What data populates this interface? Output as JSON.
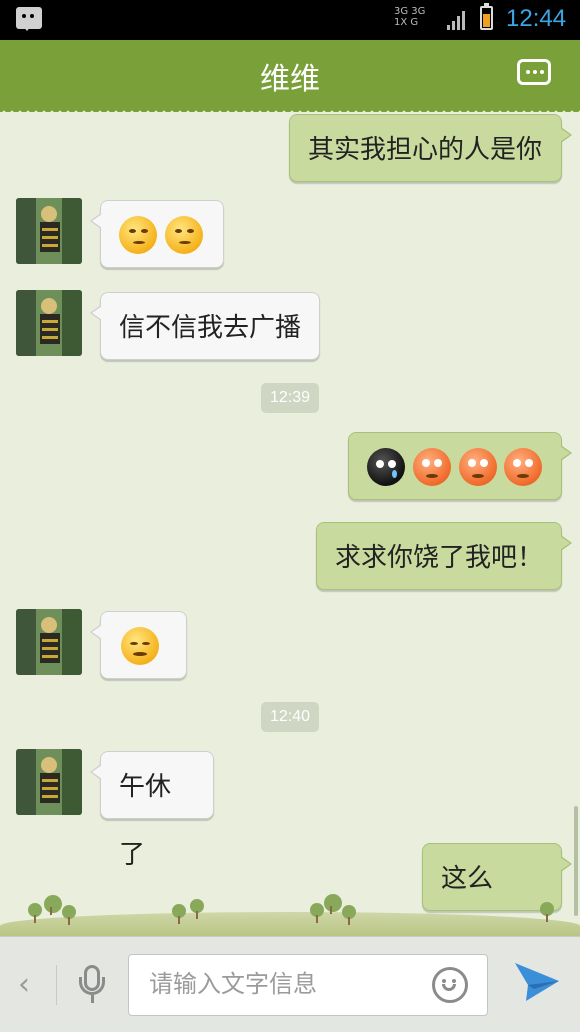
{
  "status_bar": {
    "network_top": "3G 3G 1X G",
    "time": "12:44",
    "battery_level": 0.7
  },
  "header": {
    "title": "维维",
    "menu_icon": "more-dots-icon"
  },
  "messages": [
    {
      "side": "right",
      "type": "text",
      "text": "其实我担心的人是你"
    },
    {
      "side": "left",
      "type": "emoji",
      "emojis": [
        "smirk-emoji",
        "smirk-emoji"
      ]
    },
    {
      "side": "left",
      "type": "text",
      "text": "信不信我去广播"
    },
    {
      "type": "time",
      "text": "12:39"
    },
    {
      "side": "right",
      "type": "emoji",
      "emojis": [
        "crying-black-emoji",
        "sad-red-emoji",
        "sad-red-emoji",
        "sad-red-emoji"
      ]
    },
    {
      "side": "right",
      "type": "text",
      "text": "求求你饶了我吧！"
    },
    {
      "side": "left",
      "type": "emoji",
      "emojis": [
        "content-smile-emoji"
      ]
    },
    {
      "type": "time",
      "text": "12:40"
    },
    {
      "side": "left",
      "type": "text",
      "text": "午休了"
    },
    {
      "side": "right",
      "type": "text",
      "text": "这么早？"
    }
  ],
  "input_bar": {
    "back_icon": "chevron-left-icon",
    "voice_icon": "microphone-icon",
    "placeholder": "请输入文字信息",
    "emoji_icon": "smiley-icon",
    "send_icon": "send-arrow-icon"
  },
  "colors": {
    "header": "#7aa03a",
    "background": "#e9efdc",
    "own_bubble": "#c8da9e",
    "other_bubble": "#f7f7f7",
    "time_accent": "#3aa6e6"
  }
}
